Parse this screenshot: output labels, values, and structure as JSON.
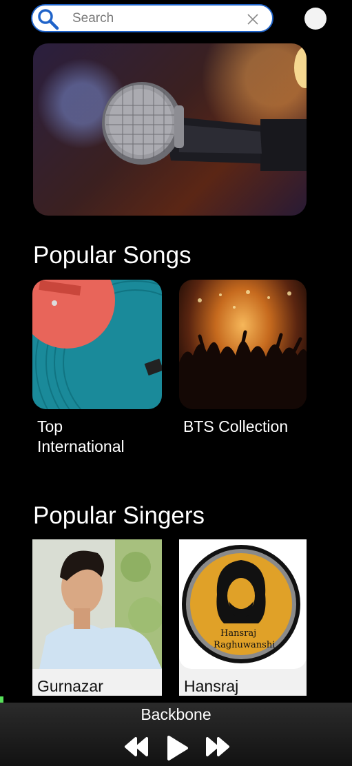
{
  "search": {
    "placeholder": "Search"
  },
  "sections": {
    "songs_title": "Popular Songs",
    "singers_title": "Popular Singers"
  },
  "songs": [
    {
      "label": "Top\nInternational"
    },
    {
      "label": "BTS Collection"
    }
  ],
  "singers": [
    {
      "name": "Gurnazar"
    },
    {
      "name": "Hansraj",
      "logo_text_1": "Hansraj",
      "logo_text_2": "Raghuwanshi"
    }
  ],
  "player": {
    "now_playing": "Backbone"
  },
  "colors": {
    "background": "#000000",
    "search_border": "#1f63c9",
    "accent_green": "#57e05a"
  },
  "icons": [
    "search-icon",
    "clear-icon",
    "avatar",
    "rewind-icon",
    "play-icon",
    "fast-forward-icon"
  ]
}
